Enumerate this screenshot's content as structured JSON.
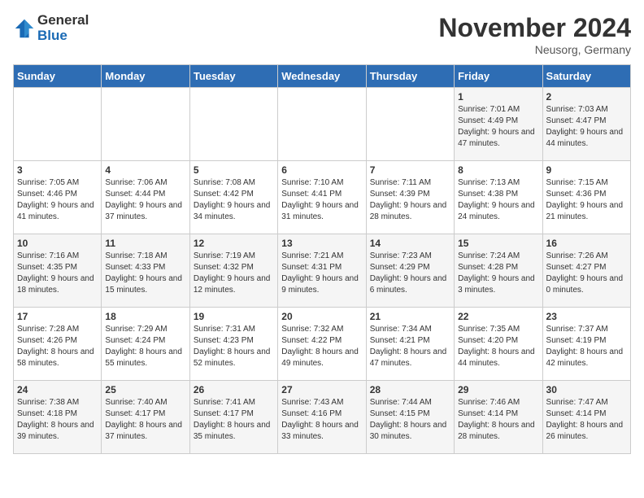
{
  "header": {
    "logo_text_general": "General",
    "logo_text_blue": "Blue",
    "month_title": "November 2024",
    "location": "Neusorg, Germany"
  },
  "calendar": {
    "days_of_week": [
      "Sunday",
      "Monday",
      "Tuesday",
      "Wednesday",
      "Thursday",
      "Friday",
      "Saturday"
    ],
    "weeks": [
      [
        {
          "day": "",
          "info": ""
        },
        {
          "day": "",
          "info": ""
        },
        {
          "day": "",
          "info": ""
        },
        {
          "day": "",
          "info": ""
        },
        {
          "day": "",
          "info": ""
        },
        {
          "day": "1",
          "info": "Sunrise: 7:01 AM\nSunset: 4:49 PM\nDaylight: 9 hours and 47 minutes."
        },
        {
          "day": "2",
          "info": "Sunrise: 7:03 AM\nSunset: 4:47 PM\nDaylight: 9 hours and 44 minutes."
        }
      ],
      [
        {
          "day": "3",
          "info": "Sunrise: 7:05 AM\nSunset: 4:46 PM\nDaylight: 9 hours and 41 minutes."
        },
        {
          "day": "4",
          "info": "Sunrise: 7:06 AM\nSunset: 4:44 PM\nDaylight: 9 hours and 37 minutes."
        },
        {
          "day": "5",
          "info": "Sunrise: 7:08 AM\nSunset: 4:42 PM\nDaylight: 9 hours and 34 minutes."
        },
        {
          "day": "6",
          "info": "Sunrise: 7:10 AM\nSunset: 4:41 PM\nDaylight: 9 hours and 31 minutes."
        },
        {
          "day": "7",
          "info": "Sunrise: 7:11 AM\nSunset: 4:39 PM\nDaylight: 9 hours and 28 minutes."
        },
        {
          "day": "8",
          "info": "Sunrise: 7:13 AM\nSunset: 4:38 PM\nDaylight: 9 hours and 24 minutes."
        },
        {
          "day": "9",
          "info": "Sunrise: 7:15 AM\nSunset: 4:36 PM\nDaylight: 9 hours and 21 minutes."
        }
      ],
      [
        {
          "day": "10",
          "info": "Sunrise: 7:16 AM\nSunset: 4:35 PM\nDaylight: 9 hours and 18 minutes."
        },
        {
          "day": "11",
          "info": "Sunrise: 7:18 AM\nSunset: 4:33 PM\nDaylight: 9 hours and 15 minutes."
        },
        {
          "day": "12",
          "info": "Sunrise: 7:19 AM\nSunset: 4:32 PM\nDaylight: 9 hours and 12 minutes."
        },
        {
          "day": "13",
          "info": "Sunrise: 7:21 AM\nSunset: 4:31 PM\nDaylight: 9 hours and 9 minutes."
        },
        {
          "day": "14",
          "info": "Sunrise: 7:23 AM\nSunset: 4:29 PM\nDaylight: 9 hours and 6 minutes."
        },
        {
          "day": "15",
          "info": "Sunrise: 7:24 AM\nSunset: 4:28 PM\nDaylight: 9 hours and 3 minutes."
        },
        {
          "day": "16",
          "info": "Sunrise: 7:26 AM\nSunset: 4:27 PM\nDaylight: 9 hours and 0 minutes."
        }
      ],
      [
        {
          "day": "17",
          "info": "Sunrise: 7:28 AM\nSunset: 4:26 PM\nDaylight: 8 hours and 58 minutes."
        },
        {
          "day": "18",
          "info": "Sunrise: 7:29 AM\nSunset: 4:24 PM\nDaylight: 8 hours and 55 minutes."
        },
        {
          "day": "19",
          "info": "Sunrise: 7:31 AM\nSunset: 4:23 PM\nDaylight: 8 hours and 52 minutes."
        },
        {
          "day": "20",
          "info": "Sunrise: 7:32 AM\nSunset: 4:22 PM\nDaylight: 8 hours and 49 minutes."
        },
        {
          "day": "21",
          "info": "Sunrise: 7:34 AM\nSunset: 4:21 PM\nDaylight: 8 hours and 47 minutes."
        },
        {
          "day": "22",
          "info": "Sunrise: 7:35 AM\nSunset: 4:20 PM\nDaylight: 8 hours and 44 minutes."
        },
        {
          "day": "23",
          "info": "Sunrise: 7:37 AM\nSunset: 4:19 PM\nDaylight: 8 hours and 42 minutes."
        }
      ],
      [
        {
          "day": "24",
          "info": "Sunrise: 7:38 AM\nSunset: 4:18 PM\nDaylight: 8 hours and 39 minutes."
        },
        {
          "day": "25",
          "info": "Sunrise: 7:40 AM\nSunset: 4:17 PM\nDaylight: 8 hours and 37 minutes."
        },
        {
          "day": "26",
          "info": "Sunrise: 7:41 AM\nSunset: 4:17 PM\nDaylight: 8 hours and 35 minutes."
        },
        {
          "day": "27",
          "info": "Sunrise: 7:43 AM\nSunset: 4:16 PM\nDaylight: 8 hours and 33 minutes."
        },
        {
          "day": "28",
          "info": "Sunrise: 7:44 AM\nSunset: 4:15 PM\nDaylight: 8 hours and 30 minutes."
        },
        {
          "day": "29",
          "info": "Sunrise: 7:46 AM\nSunset: 4:14 PM\nDaylight: 8 hours and 28 minutes."
        },
        {
          "day": "30",
          "info": "Sunrise: 7:47 AM\nSunset: 4:14 PM\nDaylight: 8 hours and 26 minutes."
        }
      ]
    ]
  }
}
